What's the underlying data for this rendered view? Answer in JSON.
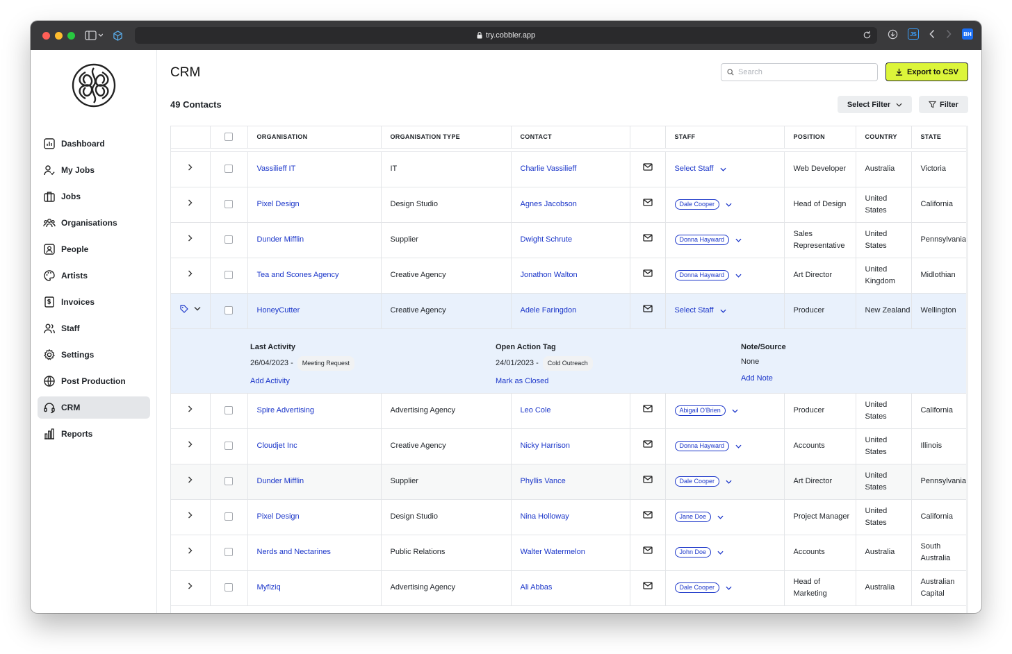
{
  "browser": {
    "url": "try.cobbler.app",
    "js_badge": "JS",
    "bh_badge": "BH"
  },
  "sidebar": {
    "items": [
      {
        "label": "Dashboard",
        "icon": "dashboard-icon"
      },
      {
        "label": "My Jobs",
        "icon": "my-jobs-icon"
      },
      {
        "label": "Jobs",
        "icon": "briefcase-icon"
      },
      {
        "label": "Organisations",
        "icon": "organisations-icon"
      },
      {
        "label": "People",
        "icon": "people-icon"
      },
      {
        "label": "Artists",
        "icon": "palette-icon"
      },
      {
        "label": "Invoices",
        "icon": "invoice-icon"
      },
      {
        "label": "Staff",
        "icon": "staff-icon"
      },
      {
        "label": "Settings",
        "icon": "gear-icon"
      },
      {
        "label": "Post Production",
        "icon": "globe-icon"
      },
      {
        "label": "CRM",
        "icon": "headset-icon",
        "active": true
      },
      {
        "label": "Reports",
        "icon": "bar-chart-icon"
      }
    ]
  },
  "header": {
    "title": "CRM",
    "search_placeholder": "Search",
    "export_label": "Export to CSV",
    "export_color": "#dcf53a"
  },
  "toolbar": {
    "count_label": "49 Contacts",
    "select_filter_label": "Select Filter",
    "filter_label": "Filter"
  },
  "table": {
    "columns": [
      "ORGANISATION",
      "ORGANISATION TYPE",
      "CONTACT",
      "STAFF",
      "POSITION",
      "COUNTRY",
      "STATE"
    ],
    "select_staff_label": "Select Staff",
    "rows": [
      {
        "org": "Vassilieff IT",
        "type": "IT",
        "contact": "Charlie Vassilieff",
        "staff": "",
        "position": "Web Developer",
        "country": "Australia",
        "state": "Victoria"
      },
      {
        "org": "Pixel Design",
        "type": "Design Studio",
        "contact": "Agnes Jacobson",
        "staff": "Dale Cooper",
        "position": "Head of Design",
        "country": "United States",
        "state": "California"
      },
      {
        "org": "Dunder Mifflin",
        "type": "Supplier",
        "contact": "Dwight Schrute",
        "staff": "Donna Hayward",
        "position": "Sales Representative",
        "country": "United States",
        "state": "Pennsylvania"
      },
      {
        "org": "Tea and Scones Agency",
        "type": "Creative Agency",
        "contact": "Jonathon Walton",
        "staff": "Donna Hayward",
        "position": "Art Director",
        "country": "United Kingdom",
        "state": "Midlothian"
      },
      {
        "org": "HoneyCutter",
        "type": "Creative Agency",
        "contact": "Adele Faringdon",
        "staff": "",
        "position": "Producer",
        "country": "New Zealand",
        "state": "Wellington",
        "expanded": true
      },
      {
        "org": "Spire Advertising",
        "type": "Advertising Agency",
        "contact": "Leo Cole",
        "staff": "Abigail O'Brien",
        "position": "Producer",
        "country": "United States",
        "state": "California"
      },
      {
        "org": "Cloudjet Inc",
        "type": "Creative Agency",
        "contact": "Nicky Harrison",
        "staff": "Donna Hayward",
        "position": "Accounts",
        "country": "United States",
        "state": "Illinois"
      },
      {
        "org": "Dunder Mifflin",
        "type": "Supplier",
        "contact": "Phyllis Vance",
        "staff": "Dale Cooper",
        "position": "Art Director",
        "country": "United States",
        "state": "Pennsylvania",
        "alt": true
      },
      {
        "org": "Pixel Design",
        "type": "Design Studio",
        "contact": "Nina Holloway",
        "staff": "Jane Doe",
        "position": "Project Manager",
        "country": "United States",
        "state": "California"
      },
      {
        "org": "Nerds and Nectarines",
        "type": "Public Relations",
        "contact": "Walter Watermelon",
        "staff": "John Doe",
        "position": "Accounts",
        "country": "Australia",
        "state": "South Australia"
      },
      {
        "org": "Myfiziq",
        "type": "Advertising Agency",
        "contact": "Ali Abbas",
        "staff": "Dale Cooper",
        "position": "Head of Marketing",
        "country": "Australia",
        "state": "Australian Capital"
      }
    ]
  },
  "detail": {
    "last_activity_label": "Last Activity",
    "last_activity_date": "26/04/2023 -",
    "last_activity_tag": "Meeting Request",
    "add_activity": "Add Activity",
    "open_action_label": "Open Action Tag",
    "open_action_date": "24/01/2023 -",
    "open_action_tag": "Cold Outreach",
    "mark_closed": "Mark as Closed",
    "note_label": "Note/Source",
    "note_value": "None",
    "add_note": "Add Note"
  }
}
